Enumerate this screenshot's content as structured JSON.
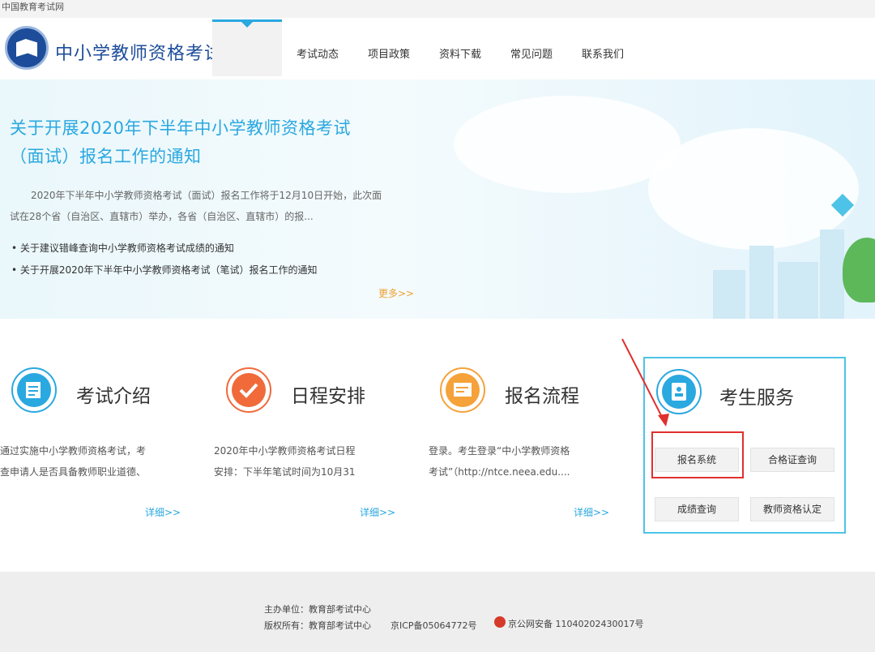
{
  "browser": {
    "title": "中国教育考试网"
  },
  "header": {
    "site_title": "中小学教师资格考试",
    "nav": [
      "考试动态",
      "项目政策",
      "资料下载",
      "常见问题",
      "联系我们"
    ]
  },
  "banner": {
    "title_line1": "关于开展2020年下半年中小学教师资格考试",
    "title_line2": "（面试）报名工作的通知",
    "desc_line1": "2020年下半年中小学教师资格考试（面试）报名工作将于12月10日开始，此次面",
    "desc_line2": "试在28个省（自治区、直辖市）举办，各省（自治区、直辖市）的报...",
    "links": [
      "关于建议错峰查询中小学教师资格考试成绩的通知",
      "关于开展2020年下半年中小学教师资格考试（笔试）报名工作的通知"
    ],
    "more": "更多>>"
  },
  "services": [
    {
      "title": "考试介绍",
      "text1": "通过实施中小学教师资格考试，考",
      "text2": "查申请人是否具备教师职业道德、",
      "more": "详细>>"
    },
    {
      "title": "日程安排",
      "text1": "2020年中小学教师资格考试日程",
      "text2": "安排：下半年笔试时间为10月31",
      "more": "详细>>"
    },
    {
      "title": "报名流程",
      "text1": "登录。考生登录“中小学教师资格",
      "text2": "考试”（http://ntce.neea.edu....",
      "more": "详细>>"
    }
  ],
  "candidate_services": {
    "title": "考生服务",
    "buttons": [
      "报名系统",
      "合格证查询",
      "成绩查询",
      "教师资格认定"
    ]
  },
  "footer": {
    "organizer": "主办单位：教育部考试中心",
    "copyright": "版权所有：教育部考试中心",
    "icp": "京ICP备05064772号",
    "police": "京公网安备 11040202430017号"
  },
  "colors": {
    "brand_blue": "#1d4d9a",
    "accent_cyan": "#2aa8e0",
    "annotation_red": "#e0302e",
    "more_orange": "#f0a030"
  }
}
